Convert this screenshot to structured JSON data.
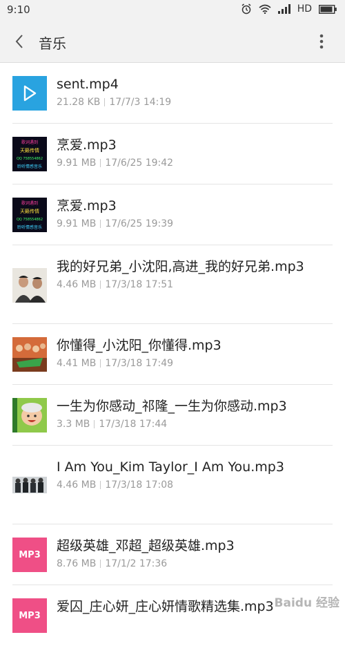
{
  "status_bar": {
    "time": "9:10",
    "network": "HD"
  },
  "header": {
    "title": "音乐"
  },
  "files": [
    {
      "name": "sent.mp4",
      "size": "21.28 KB",
      "date": "17/7/3 14:19",
      "thumb": "video-icon"
    },
    {
      "name": "烹爱.mp3",
      "size": "9.91 MB",
      "date": "17/6/25 19:42",
      "thumb": "album-art-neon"
    },
    {
      "name": "烹爱.mp3",
      "size": "9.91 MB",
      "date": "17/6/25 19:39",
      "thumb": "album-art-neon"
    },
    {
      "name": "我的好兄弟_小沈阳,高进_我的好兄弟.mp3",
      "size": "4.46 MB",
      "date": "17/3/18 17:51",
      "thumb": "album-art-portrait"
    },
    {
      "name": "你懂得_小沈阳_你懂得.mp3",
      "size": "4.41 MB",
      "date": "17/3/18 17:49",
      "thumb": "album-art-group"
    },
    {
      "name": "一生为你感动_祁隆_一生为你感动.mp3",
      "size": "3.3 MB",
      "date": "17/3/18 17:44",
      "thumb": "album-art-baby"
    },
    {
      "name": "I Am You_Kim Taylor_I Am You.mp3",
      "size": "4.46 MB",
      "date": "17/3/18 17:08",
      "thumb": "album-art-band"
    },
    {
      "name": "超级英雄_邓超_超级英雄.mp3",
      "size": "8.76 MB",
      "date": "17/1/2 17:36",
      "thumb": "mp3-icon"
    },
    {
      "name": "爱囚_庄心妍_庄心妍情歌精选集.mp3",
      "size": "",
      "date": "",
      "thumb": "mp3-icon"
    }
  ],
  "mp3_label": "MP3",
  "neon_art_text": {
    "line1": "歌词遇到",
    "line2": "天籁传情",
    "line3": "QQ 758554862",
    "line4": "聆听情感音乐"
  },
  "watermark": "Baidu 经验",
  "colors": {
    "video_blue": "#29a3e0",
    "mp3_pink": "#ef4f86"
  }
}
